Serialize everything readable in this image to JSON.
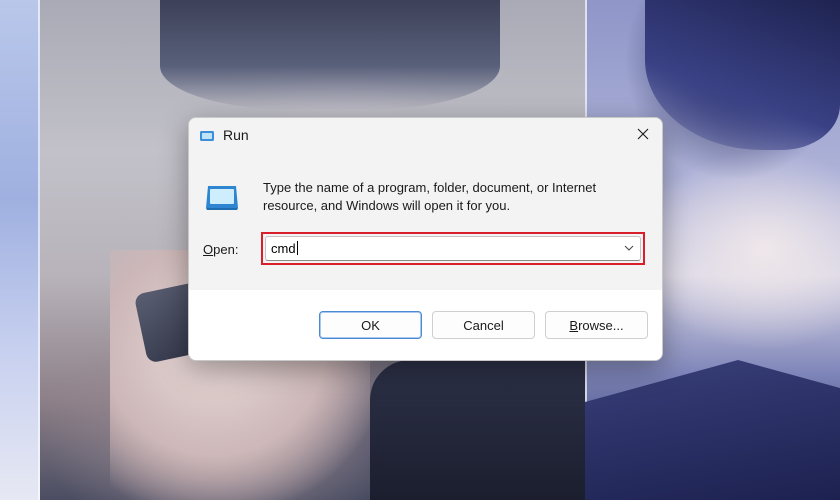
{
  "dialog": {
    "title": "Run",
    "description": "Type the name of a program, folder, document, or Internet resource, and Windows will open it for you.",
    "open_label_mnemonic": "O",
    "open_label_rest": "pen:",
    "open_value": "cmd",
    "buttons": {
      "ok": "OK",
      "cancel": "Cancel",
      "browse_mnemonic": "B",
      "browse_rest": "rowse..."
    },
    "highlight_color": "#d9202a",
    "icons": {
      "app": "run-app-icon",
      "close": "close-icon",
      "program": "run-program-icon",
      "dropdown": "chevron-down-icon"
    }
  },
  "background": {
    "description_colors": [
      "#a9aab5",
      "#8f96c8",
      "#232a5a"
    ]
  }
}
